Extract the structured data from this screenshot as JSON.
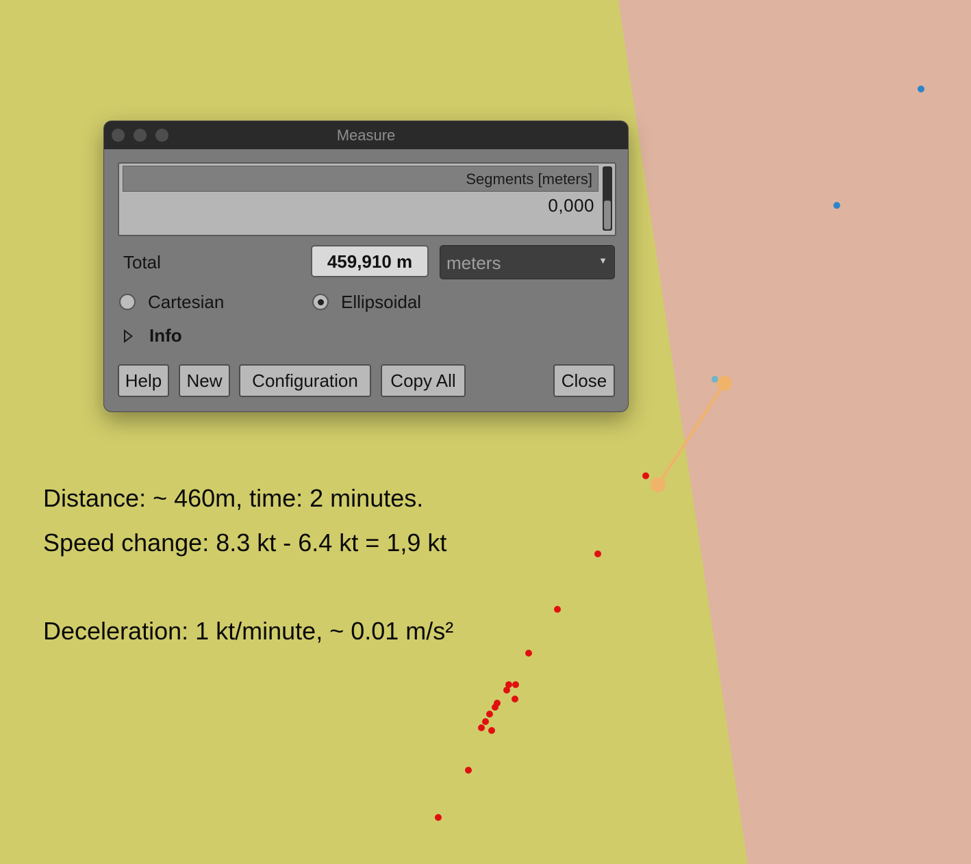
{
  "window": {
    "title": "Measure"
  },
  "segments_table": {
    "header": "Segments [meters]",
    "rows": [
      "0,000"
    ]
  },
  "total": {
    "label": "Total",
    "value": "459,910 m",
    "unit_selected": "meters"
  },
  "mode": {
    "options": [
      "Cartesian",
      "Ellipsoidal"
    ],
    "selected": "Ellipsoidal"
  },
  "info": {
    "label": "Info",
    "expanded": false
  },
  "buttons": {
    "help": "Help",
    "new": "New",
    "configuration": "Configuration",
    "copy_all": "Copy All",
    "close": "Close"
  },
  "annotations": [
    "Distance: ~ 460m, time: 2 minutes.",
    "Speed change: 8.3 kt - 6.4 kt = 1,9 kt",
    "Deceleration: 1 kt/minute, ~ 0.01 m/s²"
  ],
  "colors": {
    "land_yellow": "#d0cc6a",
    "zone_pink": "#deb3a0",
    "track_red": "#e01010",
    "point_blue": "#2b86c9",
    "measure_line": "#f0b36a"
  },
  "icons": [
    "close-window-dot",
    "minimize-window-dot",
    "zoom-window-dot",
    "radio-icon",
    "disclosure-triangle-icon",
    "dropdown-arrow-icon"
  ]
}
